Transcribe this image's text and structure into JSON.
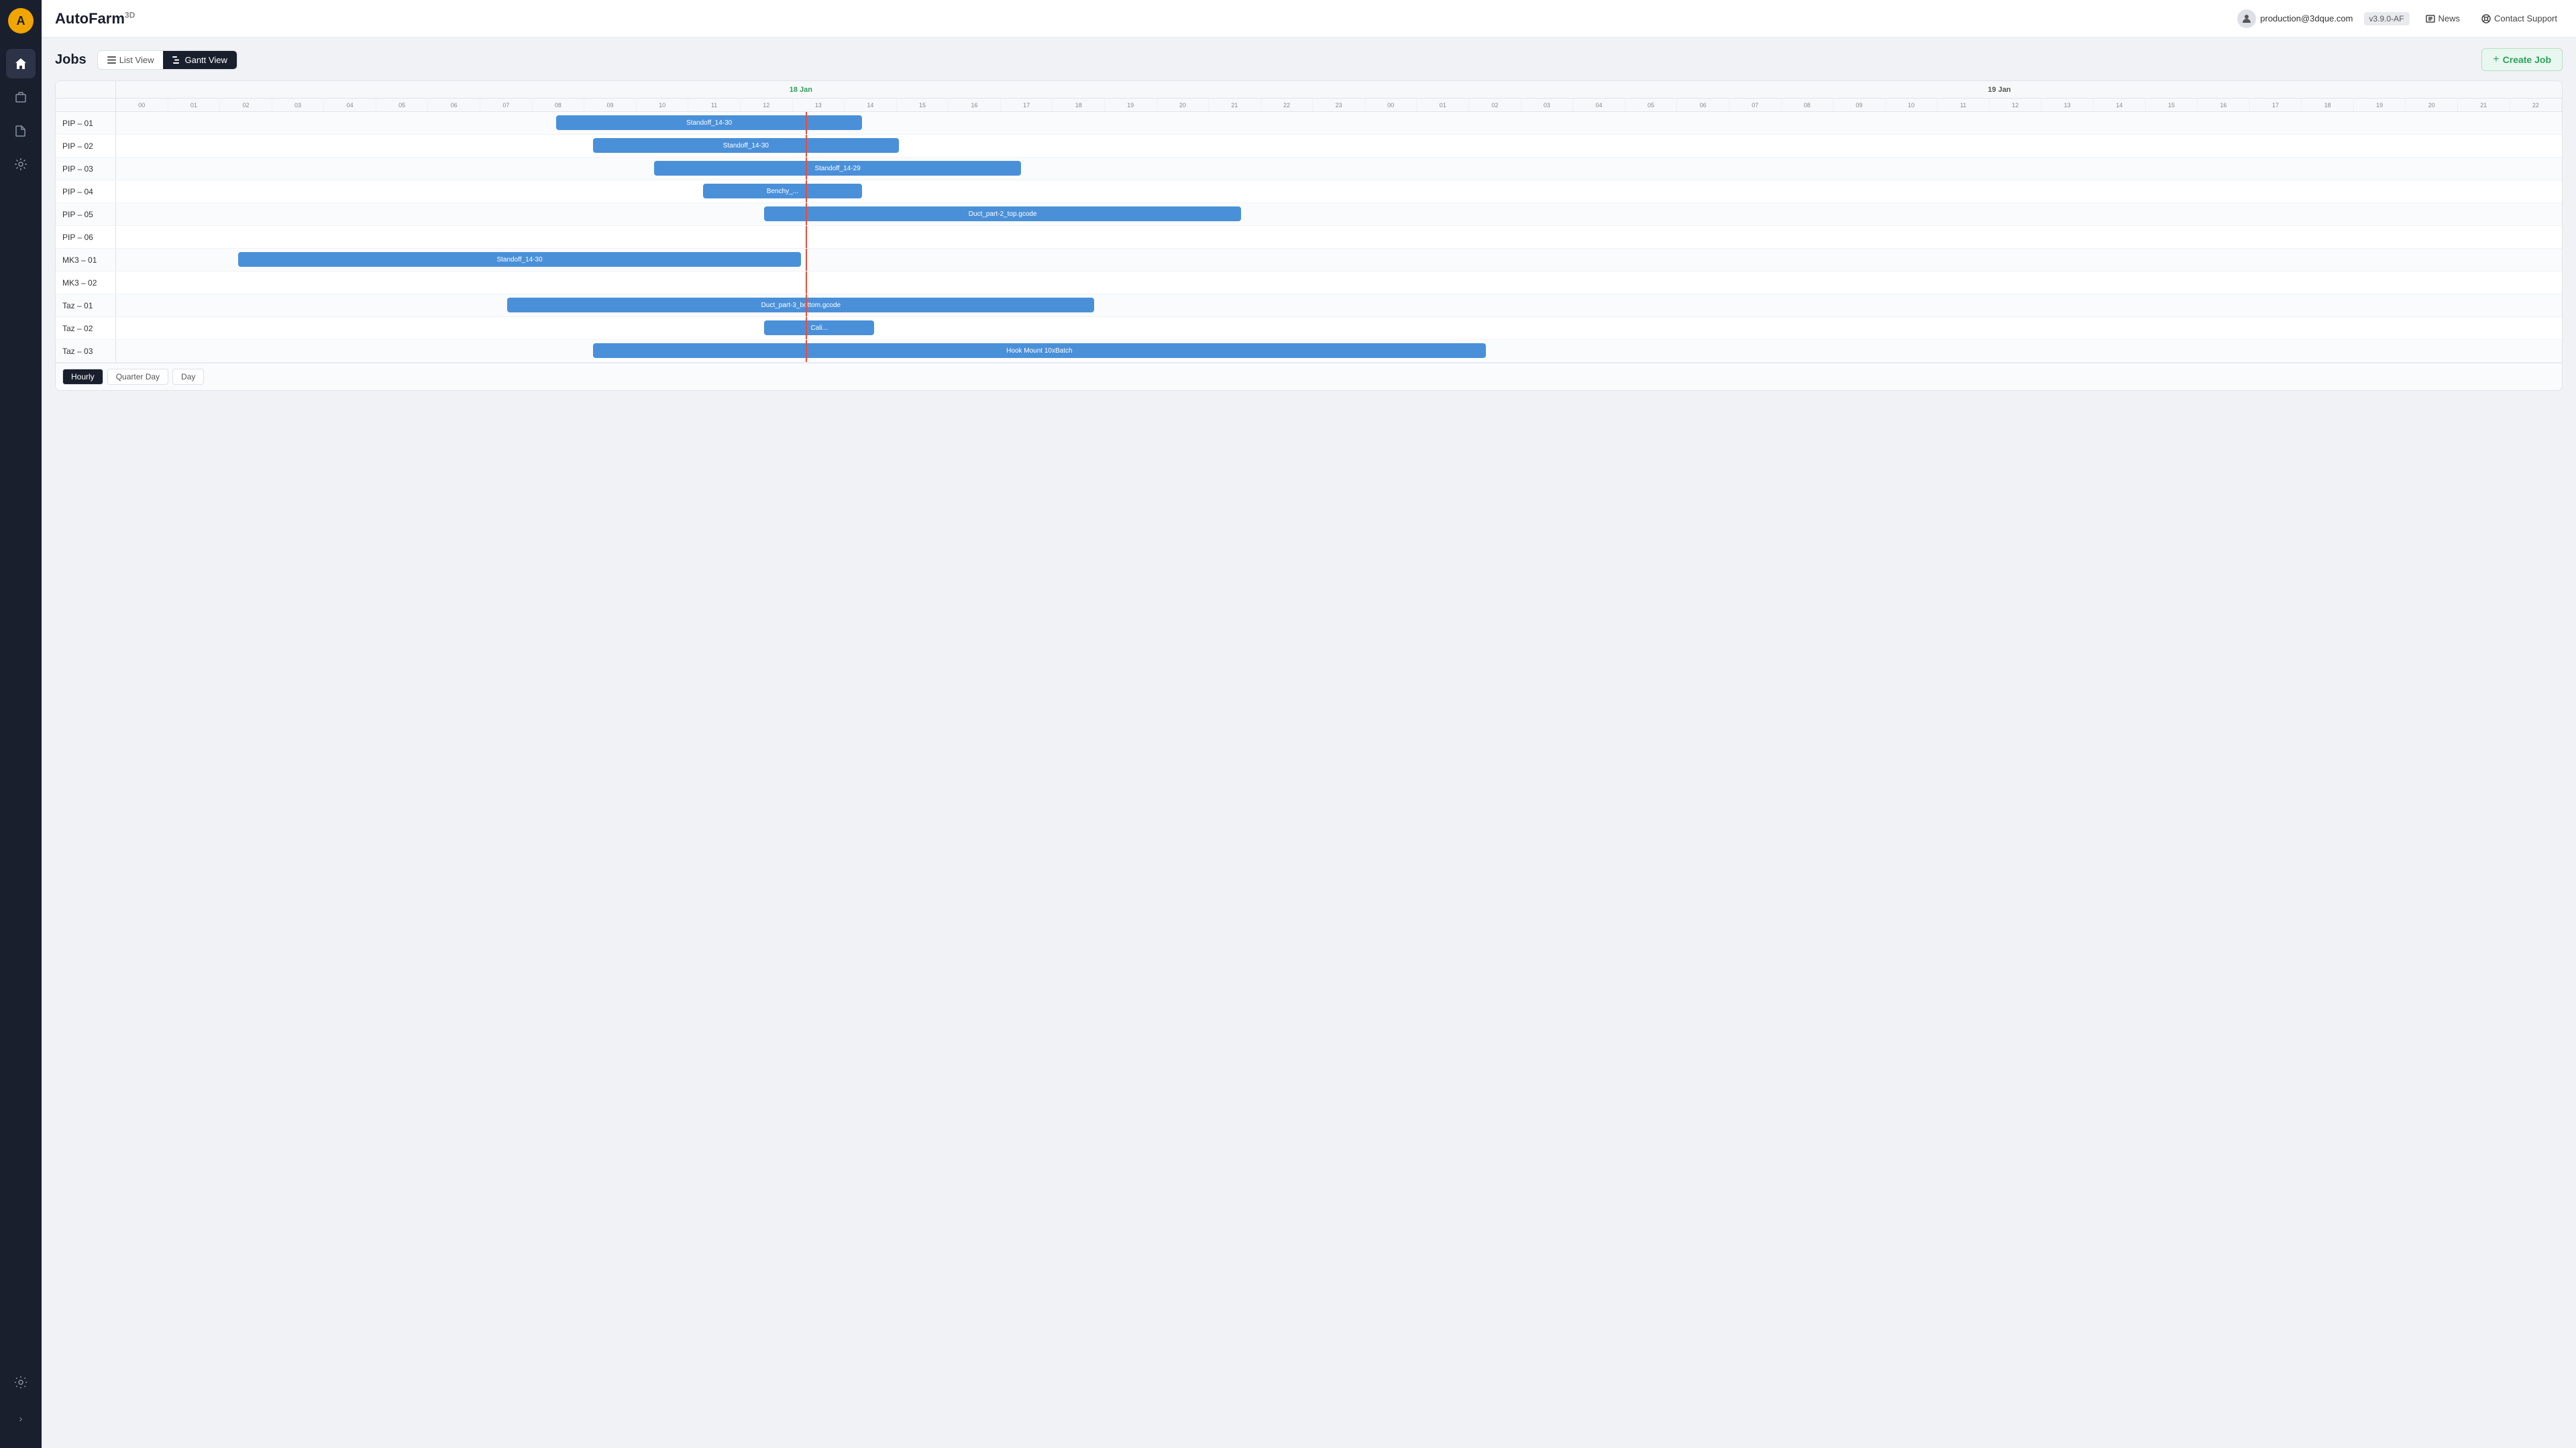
{
  "app": {
    "title": "AutoFarm",
    "title_sup": "3D",
    "logo_text": "🌾"
  },
  "topbar": {
    "user_email": "production@3dque.com",
    "version": "v3.9.0-AF",
    "news_label": "News",
    "support_label": "Contact Support"
  },
  "sidebar": {
    "items": [
      {
        "name": "home",
        "icon": "⌂",
        "active": true
      },
      {
        "name": "jobs",
        "icon": "💼",
        "active": false
      },
      {
        "name": "files",
        "icon": "📁",
        "active": false
      },
      {
        "name": "analytics",
        "icon": "⚡",
        "active": false
      }
    ],
    "bottom": [
      {
        "name": "settings",
        "icon": "⚙"
      }
    ],
    "expand_icon": "›"
  },
  "page": {
    "title": "Jobs",
    "views": [
      {
        "label": "List View",
        "active": false
      },
      {
        "label": "Gantt View",
        "active": true
      }
    ],
    "create_job_label": "Create Job"
  },
  "gantt": {
    "date_left": "18 Jan",
    "date_right": "19 Jan",
    "hours_day1": [
      "00",
      "01",
      "02",
      "03",
      "04",
      "05",
      "06",
      "07",
      "08",
      "09",
      "10",
      "11",
      "12",
      "13",
      "14",
      "15",
      "16",
      "17",
      "18",
      "19",
      "20",
      "21",
      "22",
      "23"
    ],
    "hours_day2": [
      "00",
      "01",
      "02",
      "03",
      "04",
      "05",
      "06",
      "07",
      "08",
      "09",
      "10",
      "11",
      "12",
      "13",
      "14",
      "15",
      "16",
      "17",
      "18",
      "19",
      "20",
      "21",
      "22"
    ],
    "rows": [
      {
        "label": "PIP – 01",
        "bars": [
          {
            "text": "Standoff_14-30",
            "left_pct": 18.0,
            "width_pct": 12.5
          }
        ]
      },
      {
        "label": "PIP – 02",
        "bars": [
          {
            "text": "Standoff_14-30",
            "left_pct": 19.5,
            "width_pct": 12.5
          }
        ]
      },
      {
        "label": "PIP – 03",
        "bars": [
          {
            "text": "Standoff_14-29",
            "left_pct": 22.0,
            "width_pct": 15.0
          }
        ]
      },
      {
        "label": "PIP – 04",
        "bars": [
          {
            "text": "Benchy_...",
            "left_pct": 24.0,
            "width_pct": 6.5
          }
        ]
      },
      {
        "label": "PIP – 05",
        "bars": [
          {
            "text": "Duct_part-2_top.gcode",
            "left_pct": 26.5,
            "width_pct": 19.5
          }
        ]
      },
      {
        "label": "PIP – 06",
        "bars": []
      },
      {
        "label": "MK3 – 01",
        "bars": [
          {
            "text": "Standoff_14-30",
            "left_pct": 5.0,
            "width_pct": 23.0
          }
        ]
      },
      {
        "label": "MK3 – 02",
        "bars": []
      },
      {
        "label": "Taz – 01",
        "bars": [
          {
            "text": "Duct_part-3_bottom.gcode",
            "left_pct": 16.0,
            "width_pct": 24.0
          }
        ]
      },
      {
        "label": "Taz – 02",
        "bars": [
          {
            "text": "Cali...",
            "left_pct": 26.5,
            "width_pct": 4.5
          }
        ]
      },
      {
        "label": "Taz – 03",
        "bars": [
          {
            "text": "Hook Mount 10xBatch",
            "left_pct": 19.5,
            "width_pct": 36.5
          }
        ]
      }
    ],
    "time_scales": [
      {
        "label": "Hourly",
        "active": true
      },
      {
        "label": "Quarter Day",
        "active": false
      },
      {
        "label": "Day",
        "active": false
      }
    ],
    "today_line_pct": 28.2
  }
}
